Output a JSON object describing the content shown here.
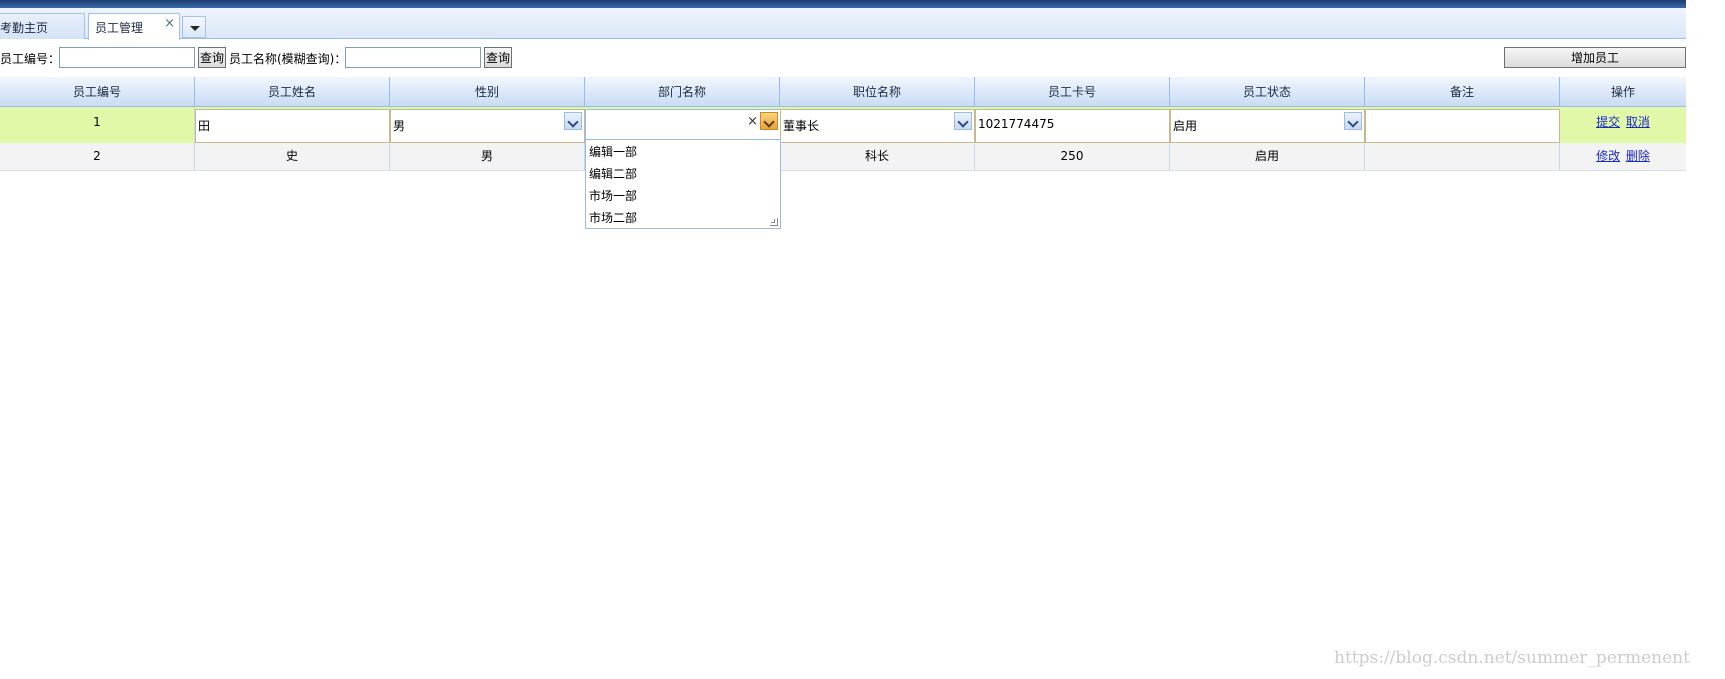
{
  "tabs": [
    {
      "label": "考勤主页",
      "active": false
    },
    {
      "label": "员工管理",
      "active": true,
      "closable": true
    }
  ],
  "tab_close_icon": "×",
  "toolbar": {
    "emp_no_label": "员工编号：",
    "emp_no_value": "",
    "query_label_1": "查询",
    "emp_name_label": "员工名称(模糊查询)：",
    "emp_name_value": "",
    "query_label_2": "查询",
    "add_label": "增加员工"
  },
  "table": {
    "columns": [
      "员工编号",
      "员工姓名",
      "性别",
      "部门名称",
      "职位名称",
      "员工卡号",
      "员工状态",
      "备注",
      "操作"
    ],
    "edit_row": {
      "id": "1",
      "name": "田",
      "gender": "男",
      "department": "",
      "position": "董事长",
      "card_no": "1021774475",
      "status": "启用",
      "remark": "",
      "actions": [
        "提交",
        "取消"
      ]
    },
    "rows": [
      {
        "id": "2",
        "name": "史",
        "gender": "男",
        "department": "",
        "position": "科长",
        "card_no": "250",
        "status": "启用",
        "remark": "",
        "actions": [
          "修改",
          "删除"
        ]
      }
    ]
  },
  "department_dropdown": {
    "clear_icon": "×",
    "options": [
      "编辑一部",
      "编辑二部",
      "市场一部",
      "市场二部"
    ]
  },
  "watermark": "https://blog.csdn.net/summer_permenent",
  "colors": {
    "header_bar": "#1d3d72",
    "edit_row_bg": "#e1f8a8",
    "row_bg": "#f3f3f3",
    "grid_border": "#99bbe8",
    "link": "#1a29c9",
    "active_trigger": "#e9a43a"
  }
}
